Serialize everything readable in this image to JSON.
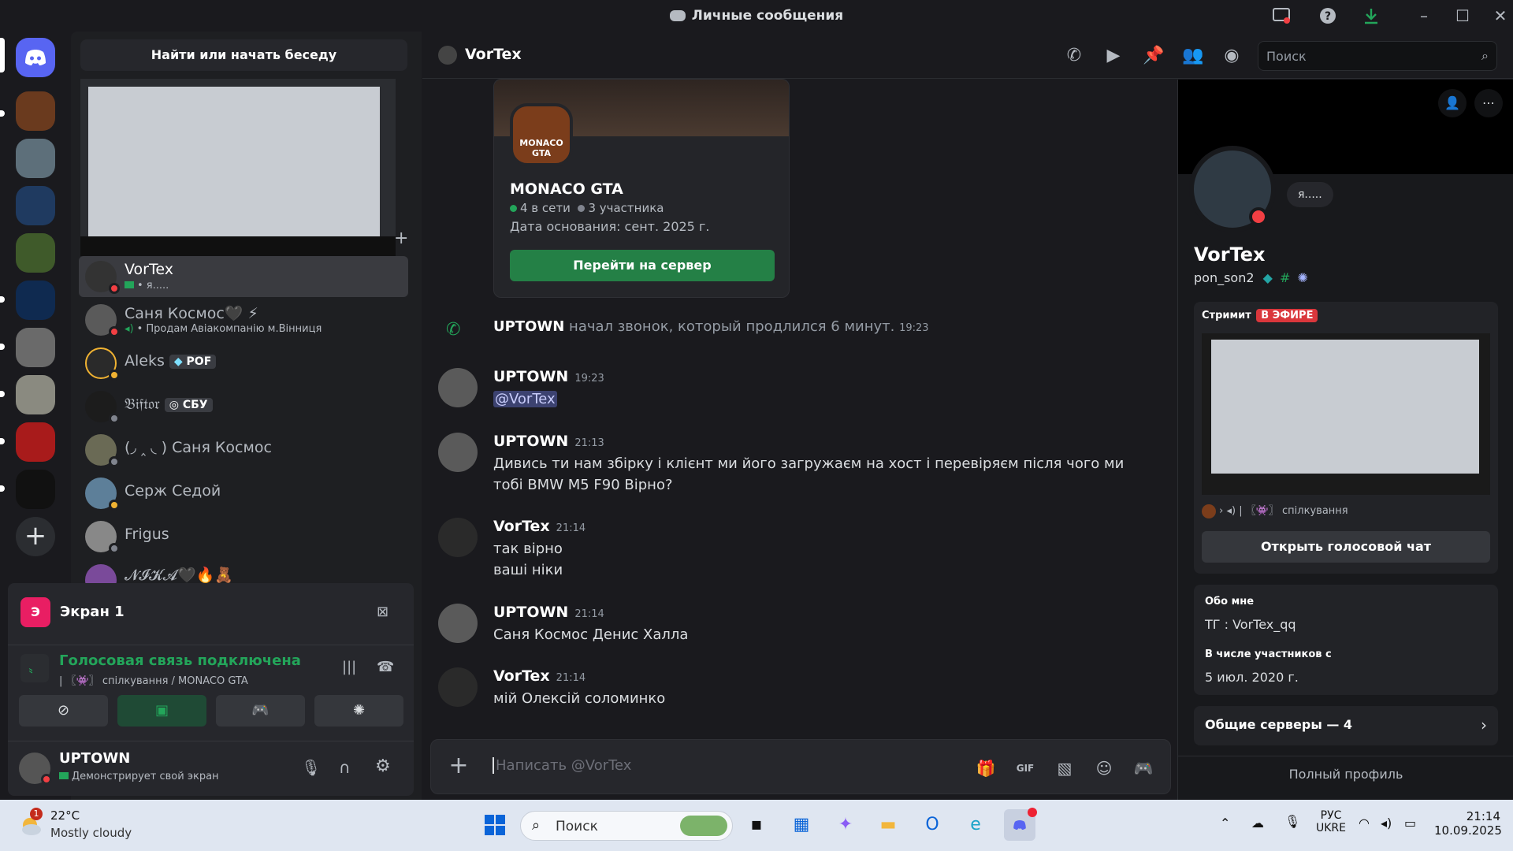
{
  "window": {
    "title": "Личные сообщения"
  },
  "dm_sidebar": {
    "search_label": "Найти или начать беседу",
    "items": [
      {
        "name": "VorTex",
        "sub": "• я.....",
        "active": true
      },
      {
        "name": "Саня Космос🖤 ⚡",
        "sub": "• Продам Авіакомпанію м.Вінниця"
      },
      {
        "name": "Aleks",
        "badge": "POF"
      },
      {
        "name": "𝔅𝔦𝔣𝔱𝔬𝔯",
        "badge": "СБУ"
      },
      {
        "name": "(◞ ‸ ◟ ) Саня Космос"
      },
      {
        "name": "Серж Седой"
      },
      {
        "name": "Frigus"
      },
      {
        "name": "𝓝𝓘𝓚𝓐🖤🔥🧸"
      }
    ],
    "screen_title": "Экран 1",
    "voice_status": "Голосовая связь подключена",
    "voice_channel": "| 〖👾〗 спілкування / MONACO GTA",
    "user": {
      "name": "UPTOWN",
      "status": "Демонстрирует свой экран"
    }
  },
  "chat": {
    "header_name": "VorTex",
    "search_placeholder": "Поиск",
    "invite": {
      "icon_text": "MONACO GTA",
      "name": "MONACO GTA",
      "online": "4 в сети",
      "members": "3 участника",
      "founded": "Дата основания: сент. 2025 г.",
      "button": "Перейти на сервер"
    },
    "call": {
      "author": "UPTOWN",
      "text": "начал звонок, который продлился 6 минут.",
      "time": "19:23"
    },
    "messages": [
      {
        "author": "UPTOWN",
        "time": "19:23",
        "lines": [
          "@VorTex"
        ]
      },
      {
        "author": "UPTOWN",
        "time": "21:13",
        "lines": [
          "Дивись ти нам збірку і клієнт ми його загружаєм на хост і перевіряєм після чого ми тобі BMW M5 F90 Вірно?"
        ]
      },
      {
        "author": "VorTex",
        "time": "21:14",
        "lines": [
          "так вірно",
          "ваші ніки"
        ]
      },
      {
        "author": "UPTOWN",
        "time": "21:14",
        "lines": [
          "Саня Космос Денис Халла"
        ]
      },
      {
        "author": "VorTex",
        "time": "21:14",
        "lines": [
          "мій Олексій соломинко"
        ]
      }
    ],
    "composer_placeholder": "Написать @VorTex"
  },
  "profile": {
    "display_name": "VorTex",
    "username": "pon_son2",
    "bubble": "я.....",
    "streaming_label": "Стримит",
    "live_badge": "В ЭФИРЕ",
    "voice_channel": "〖👾〗 спілкування",
    "open_voice_chat": "Открыть голосовой чат",
    "about_title": "Обо мне",
    "about_text": "ТГ : VorTex_qq",
    "member_since_title": "В числе участников с",
    "member_since": "5 июл. 2020 г.",
    "mutual_servers": "Общие серверы — 4",
    "full_profile": "Полный профиль"
  },
  "taskbar": {
    "weather_temp": "22°C",
    "weather_desc": "Mostly cloudy",
    "weather_badge": "1",
    "search": "Поиск",
    "lang_top": "РУС",
    "lang_bottom": "UKRE",
    "time": "21:14",
    "date": "10.09.2025"
  },
  "colors": {
    "accent": "#5865f2",
    "online": "#23a55a",
    "dnd": "#f23f43",
    "idle": "#f0b232",
    "live": "#da373c",
    "button_green": "#248046"
  }
}
